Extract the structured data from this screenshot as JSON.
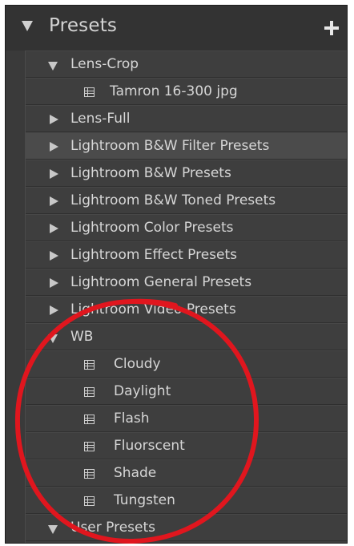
{
  "panel": {
    "title": "Presets"
  },
  "tree": {
    "lens_crop": "Lens-Crop",
    "tamron": "Tamron 16-300 jpg",
    "lens_full": "Lens-Full",
    "bw_filter": "Lightroom B&W Filter Presets",
    "bw": "Lightroom B&W Presets",
    "bw_toned": "Lightroom B&W Toned Presets",
    "color": "Lightroom Color Presets",
    "effect": "Lightroom Effect Presets",
    "general": "Lightroom General Presets",
    "video": "Lightroom Video Presets",
    "wb": "WB",
    "wb_items": [
      "Cloudy",
      "Daylight",
      "Flash",
      "Fluorscent",
      "Shade",
      "Tungsten"
    ],
    "user_presets": "User Presets"
  },
  "annotation": {
    "color": "#e0161e"
  },
  "icons": {
    "collapse": "triangle-down-icon",
    "expand": "triangle-right-icon",
    "preset": "preset-file-icon",
    "add": "plus-icon"
  }
}
